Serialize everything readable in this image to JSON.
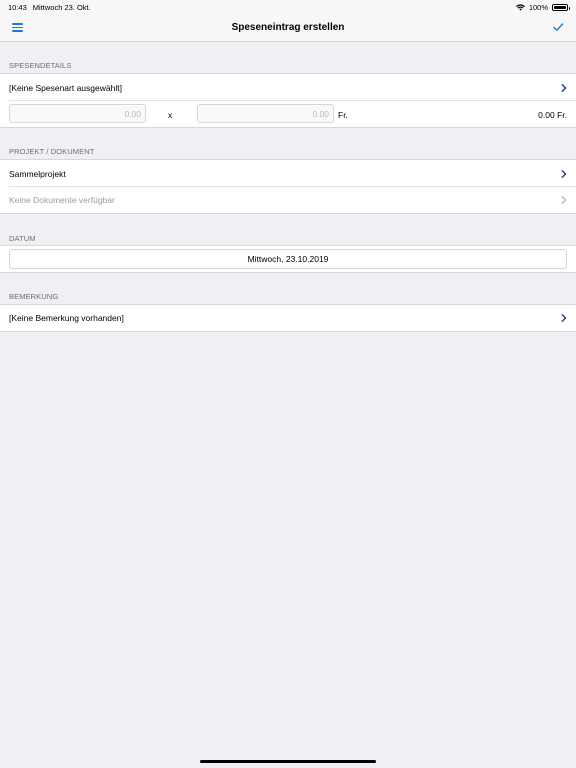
{
  "status_bar": {
    "time": "10:43",
    "date": "Mittwoch 23. Okt.",
    "battery": "100%"
  },
  "nav": {
    "title": "Speseneintrag erstellen"
  },
  "sections": {
    "spesendetails": {
      "header": "SPESENDETAILS",
      "spesenart": "[Keine Spesenart ausgewählt]",
      "quantity": "0.00",
      "multiply": "x",
      "price": "0.00",
      "currency": "Fr.",
      "total": "0.00 Fr."
    },
    "projekt": {
      "header": "PROJEKT / DOKUMENT",
      "projekt": "Sammelprojekt",
      "dokumente": "Keine Dokumente verfügbar"
    },
    "datum": {
      "header": "DATUM",
      "value": "Mittwoch, 23.10.2019"
    },
    "bemerkung": {
      "header": "BEMERKUNG",
      "value": "[Keine Bemerkung vorhanden]"
    }
  },
  "colors": {
    "accent": "#1b7ad6",
    "chevron": "#1a3d8f",
    "background": "#efeff4"
  }
}
